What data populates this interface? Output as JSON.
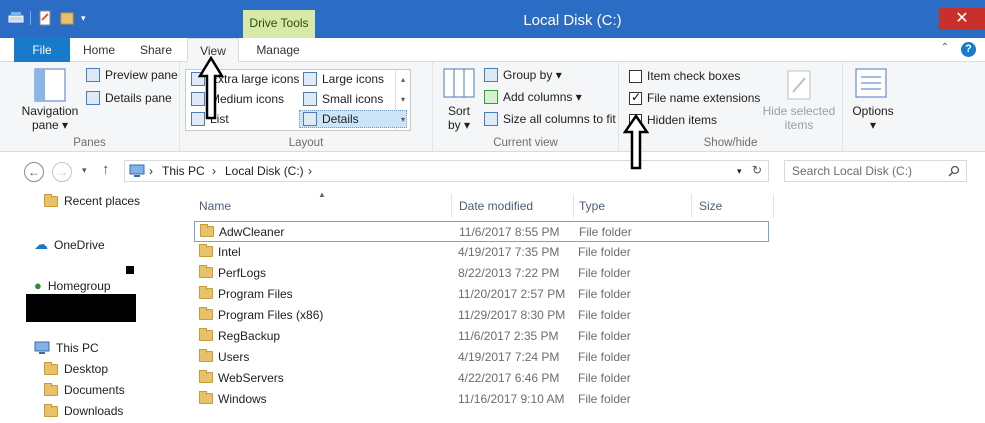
{
  "window": {
    "title": "Local Disk (C:)",
    "close": "✕",
    "context_tab_group": "Drive Tools"
  },
  "tabs": {
    "file": "File",
    "home": "Home",
    "share": "Share",
    "view": "View",
    "manage": "Manage"
  },
  "ribbon": {
    "panes": {
      "label": "Panes",
      "navigation_pane": "Navigation\npane ▾",
      "preview_pane": "Preview pane",
      "details_pane": "Details pane"
    },
    "layout": {
      "label": "Layout",
      "extra_large_icons": "Extra large icons",
      "large_icons": "Large icons",
      "medium_icons": "Medium icons",
      "small_icons": "Small icons",
      "list": "List",
      "details": "Details"
    },
    "current_view": {
      "label": "Current view",
      "sort_by": "Sort\nby ▾",
      "group_by": "Group by ▾",
      "add_columns": "Add columns ▾",
      "size_all_columns": "Size all columns to fit"
    },
    "show_hide": {
      "label": "Show/hide",
      "item_check_boxes": "Item check boxes",
      "item_check_boxes_checked": false,
      "file_name_extensions": "File name extensions",
      "file_name_extensions_checked": true,
      "hidden_items": "Hidden items",
      "hidden_items_checked": false,
      "hide_selected_items": "Hide selected\nitems"
    },
    "options": "Options\n▾"
  },
  "address": {
    "this_pc": "This PC",
    "sep": "›",
    "local_disk": "Local Disk (C:)"
  },
  "search": {
    "placeholder": "Search Local Disk (C:)"
  },
  "navpane": {
    "recent_places": "Recent places",
    "onedrive": "OneDrive",
    "homegroup": "Homegroup",
    "this_pc": "This PC",
    "desktop": "Desktop",
    "documents": "Documents",
    "downloads": "Downloads"
  },
  "columns": {
    "name": "Name",
    "date_modified": "Date modified",
    "type": "Type",
    "size": "Size"
  },
  "files": [
    {
      "name": "AdwCleaner",
      "date": "11/6/2017 8:55 PM",
      "type": "File folder"
    },
    {
      "name": "Intel",
      "date": "4/19/2017 7:35 PM",
      "type": "File folder"
    },
    {
      "name": "PerfLogs",
      "date": "8/22/2013 7:22 PM",
      "type": "File folder"
    },
    {
      "name": "Program Files",
      "date": "11/20/2017 2:57 PM",
      "type": "File folder"
    },
    {
      "name": "Program Files (x86)",
      "date": "11/29/2017 8:30 PM",
      "type": "File folder"
    },
    {
      "name": "RegBackup",
      "date": "11/6/2017 2:35 PM",
      "type": "File folder"
    },
    {
      "name": "Users",
      "date": "4/19/2017 7:24 PM",
      "type": "File folder"
    },
    {
      "name": "WebServers",
      "date": "4/22/2017 6:46 PM",
      "type": "File folder"
    },
    {
      "name": "Windows",
      "date": "11/16/2017 9:10 AM",
      "type": "File folder"
    }
  ],
  "colors": {
    "titlebar": "#2b6cc4",
    "file_tab": "#1979ca",
    "close": "#c9302c"
  }
}
